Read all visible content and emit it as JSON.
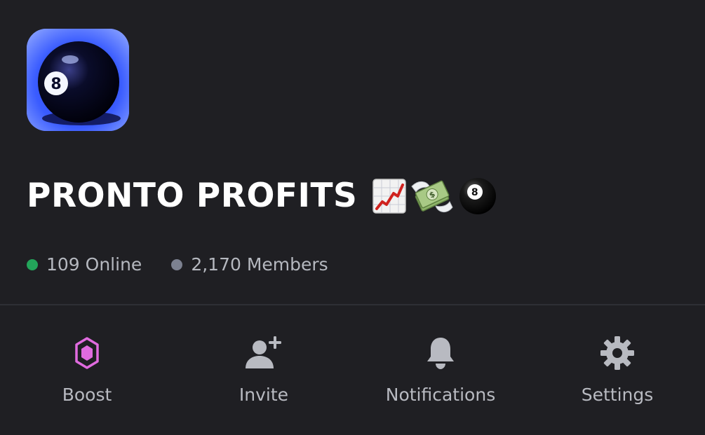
{
  "server": {
    "name": "PRONTO PROFITS",
    "icon": "eight-ball-icon",
    "name_emojis": [
      "chart-increasing-icon",
      "money-with-wings-icon",
      "pool-8-ball-icon"
    ],
    "online_label": "109 Online",
    "members_label": "2,170 Members"
  },
  "actions": [
    {
      "label": "Boost",
      "icon": "boost-gem-icon",
      "color": "#e06bdf"
    },
    {
      "label": "Invite",
      "icon": "add-user-icon",
      "color": "#b8bac1"
    },
    {
      "label": "Notifications",
      "icon": "bell-icon",
      "color": "#b8bac1"
    },
    {
      "label": "Settings",
      "icon": "gear-icon",
      "color": "#b8bac1"
    }
  ],
  "colors": {
    "background": "#1f1f23",
    "online": "#23a55a",
    "members": "#7c8190",
    "boost": "#e06bdf"
  }
}
